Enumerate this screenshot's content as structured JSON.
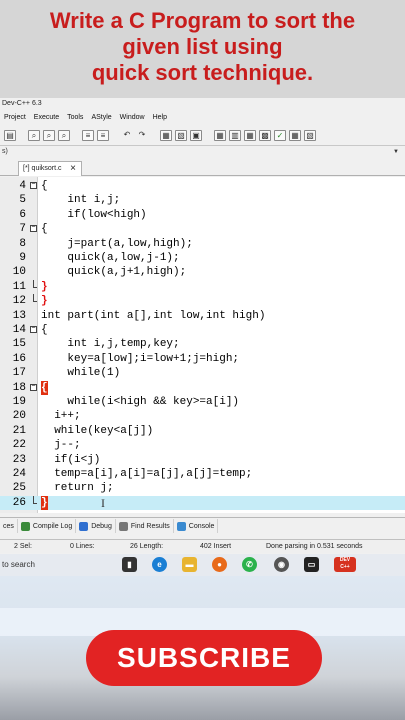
{
  "overlay": {
    "title_lines": [
      "Write a C Program to sort the",
      "given list using",
      "quick sort technique."
    ],
    "subscribe_label": "SUBSCRIBE"
  },
  "window": {
    "title": "Dev-C++ 6.3",
    "menu": [
      "Project",
      "Execute",
      "Tools",
      "AStyle",
      "Window",
      "Help"
    ],
    "subbar_text": "s)",
    "file_tab": "[*] quiksort.c"
  },
  "code_lines": [
    {
      "n": "4",
      "text": "{",
      "fold": "open"
    },
    {
      "n": "5",
      "text": "    int i,j;"
    },
    {
      "n": "6",
      "text": "    if(low<high)"
    },
    {
      "n": "7",
      "text": "{",
      "fold": "open"
    },
    {
      "n": "8",
      "text": "    j=part(a,low,high);"
    },
    {
      "n": "9",
      "text": "    quick(a,low,j-1);"
    },
    {
      "n": "10",
      "text": "    quick(a,j+1,high);"
    },
    {
      "n": "11",
      "text": "}",
      "fold": "end",
      "red": true
    },
    {
      "n": "12",
      "text": "}",
      "fold": "end",
      "red": true
    },
    {
      "n": "13",
      "text": "int part(int a[],int low,int high)"
    },
    {
      "n": "14",
      "text": "{",
      "fold": "open"
    },
    {
      "n": "15",
      "text": "    int i,j,temp,key;"
    },
    {
      "n": "16",
      "text": "    key=a[low];i=low+1;j=high;"
    },
    {
      "n": "17",
      "text": "    while(1)"
    },
    {
      "n": "18",
      "text": "{",
      "fold": "open",
      "bracehl": true
    },
    {
      "n": "19",
      "text": "    while(i<high && key>=a[i])"
    },
    {
      "n": "20",
      "text": "  i++;"
    },
    {
      "n": "21",
      "text": "  while(key<a[j])"
    },
    {
      "n": "22",
      "text": "  j--;"
    },
    {
      "n": "23",
      "text": "  if(i<j)"
    },
    {
      "n": "24",
      "text": "  temp=a[i],a[i]=a[j],a[j]=temp;"
    },
    {
      "n": "25",
      "text": "  return j;"
    },
    {
      "n": "26",
      "text": "}",
      "fold": "end",
      "bracehl": true,
      "highlight": true
    }
  ],
  "panel_tabs": [
    {
      "label": "ces",
      "color": "#f0f0f0"
    },
    {
      "label": "Compile Log",
      "color": "#3a8a3a"
    },
    {
      "label": "Debug",
      "color": "#2f6fd0"
    },
    {
      "label": "Find Results",
      "color": "#666666"
    },
    {
      "label": "Console",
      "color": "#3a8ad0"
    }
  ],
  "status": {
    "sel": "2 Sel:",
    "lines": "0 Lines:",
    "length": "26 Length:",
    "insert": "402 Insert",
    "parsing": "Done parsing in 0.531 seconds"
  },
  "taskbar": {
    "search": "to search",
    "icons": [
      "task-view-icon",
      "edge-icon",
      "file-explorer-icon",
      "firefox-icon",
      "whatsapp-icon",
      "chrome-icon",
      "terminal-icon",
      "devcpp-icon"
    ]
  },
  "colors": {
    "title_red": "#c81d1d",
    "subscribe_red": "#e22323",
    "line_highlight": "#c6ecf7",
    "brace_red": "#e01010"
  }
}
